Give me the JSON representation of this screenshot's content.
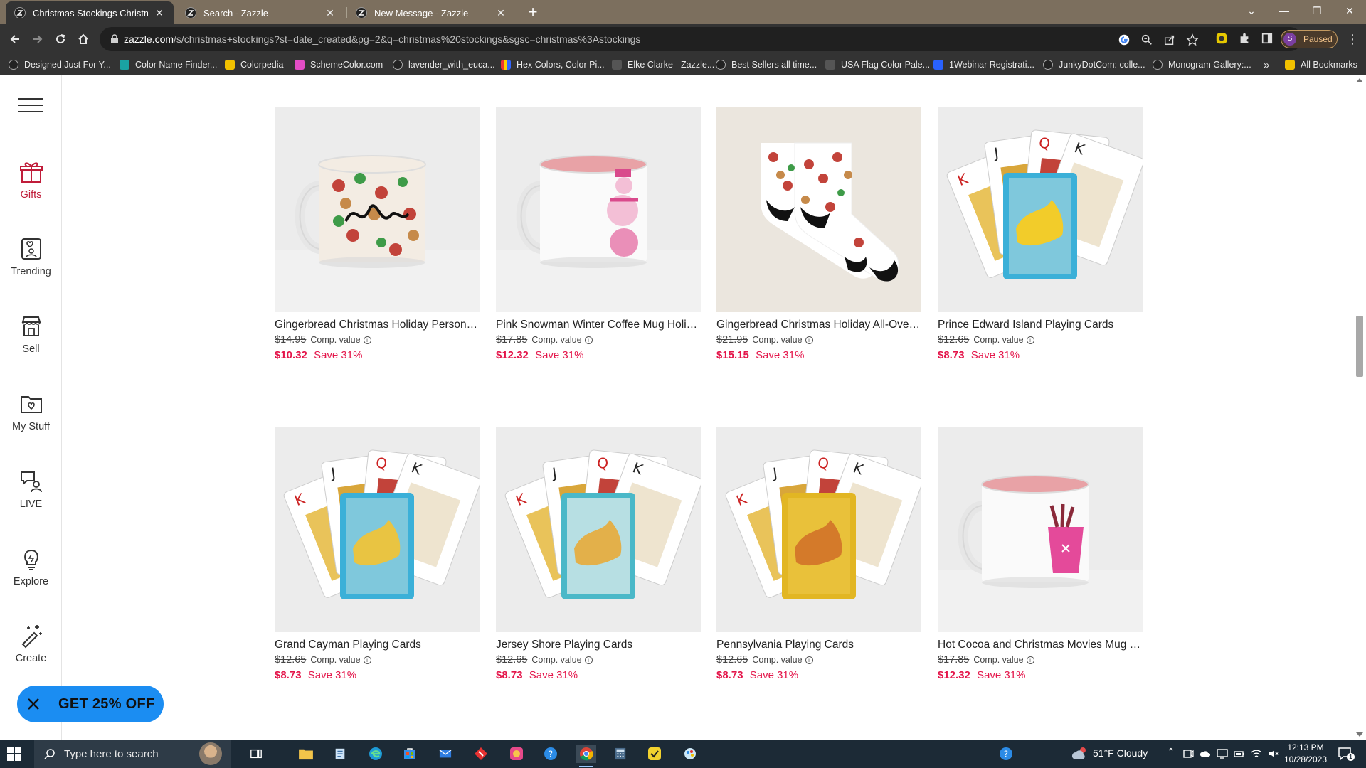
{
  "browser": {
    "tabs": [
      {
        "title": "Christmas Stockings Christmas S",
        "active": true
      },
      {
        "title": "Search - Zazzle",
        "active": false
      },
      {
        "title": "New Message - Zazzle",
        "active": false
      }
    ],
    "url_domain": "zazzle.com",
    "url_path": "/s/christmas+stockings?st=date_created&pg=2&q=christmas%20stockings&sgsc=christmas%3Astockings",
    "profile_initial": "S",
    "profile_status": "Paused"
  },
  "bookmarks": [
    {
      "label": "Designed Just For Y...",
      "color": "#222222"
    },
    {
      "label": "Color Name Finder...",
      "color": "#1aa3a3"
    },
    {
      "label": "Colorpedia",
      "color": "#f2c200"
    },
    {
      "label": "SchemeColor.com",
      "color": "#e34dc5"
    },
    {
      "label": "lavender_with_euca...",
      "color": "#222222"
    },
    {
      "label": "Hex Colors, Color Pi...",
      "color": "#2f6fe0"
    },
    {
      "label": "Elke Clarke - Zazzle...",
      "color": "#555555"
    },
    {
      "label": "Best Sellers all time...",
      "color": "#222222"
    },
    {
      "label": "USA Flag Color Pale...",
      "color": "#555555"
    },
    {
      "label": "1Webinar Registrati...",
      "color": "#2962ff"
    },
    {
      "label": "JunkyDotCom: colle...",
      "color": "#222222"
    },
    {
      "label": "Monogram Gallery:...",
      "color": "#222222"
    }
  ],
  "bookmarks_overflow": "»",
  "all_bookmarks": "All Bookmarks",
  "rail": {
    "gifts": "Gifts",
    "trending": "Trending",
    "sell": "Sell",
    "mystuff": "My Stuff",
    "live": "LIVE",
    "explore": "Explore",
    "create": "Create"
  },
  "promo": {
    "label": "GET 25% OFF"
  },
  "comp_label": "Comp. value",
  "products": [
    {
      "name": "Gingerbread Christmas Holiday Personal...",
      "original": "$14.95",
      "sale": "$10.32",
      "save": "Save 31%",
      "kind": "mug-gingerbread"
    },
    {
      "name": "Pink Snowman Winter Coffee Mug Holid...",
      "original": "$17.85",
      "sale": "$12.32",
      "save": "Save 31%",
      "kind": "mug-snowman"
    },
    {
      "name": "Gingerbread Christmas Holiday All-Over-...",
      "original": "$21.95",
      "sale": "$15.15",
      "save": "Save 31%",
      "kind": "socks"
    },
    {
      "name": "Prince Edward Island Playing Cards",
      "original": "$12.65",
      "sale": "$8.73",
      "save": "Save 31%",
      "kind": "cards-blue"
    },
    {
      "name": "Grand Cayman Playing Cards",
      "original": "$12.65",
      "sale": "$8.73",
      "save": "Save 31%",
      "kind": "cards-cayman"
    },
    {
      "name": "Jersey Shore Playing Cards",
      "original": "$12.65",
      "sale": "$8.73",
      "save": "Save 31%",
      "kind": "cards-jersey"
    },
    {
      "name": "Pennsylvania Playing Cards",
      "original": "$12.65",
      "sale": "$8.73",
      "save": "Save 31%",
      "kind": "cards-penn"
    },
    {
      "name": "Hot Cocoa and Christmas Movies Mug Pi...",
      "original": "$17.85",
      "sale": "$12.32",
      "save": "Save 31%",
      "kind": "mug-cocoa"
    }
  ],
  "taskbar": {
    "search_placeholder": "Type here to search",
    "weather": "51°F  Cloudy",
    "time": "12:13 PM",
    "date": "10/28/2023",
    "notification_count": "1"
  }
}
